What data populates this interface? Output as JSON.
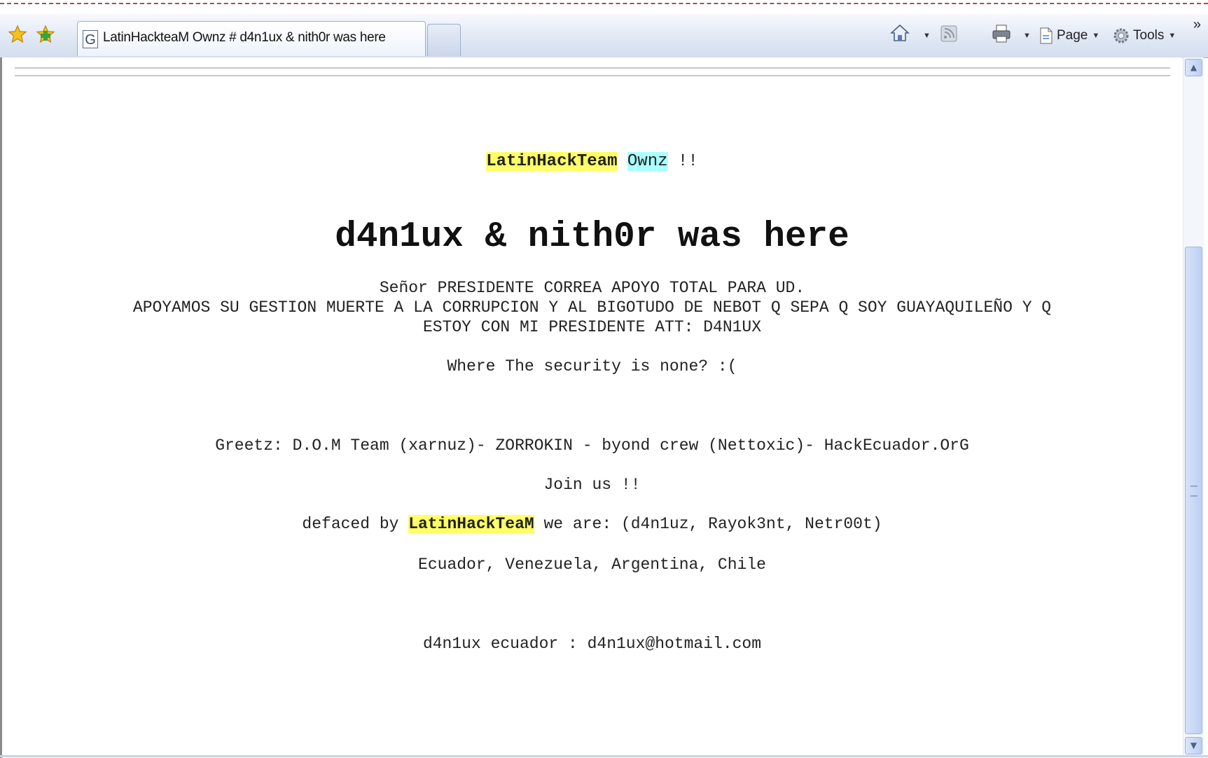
{
  "browser": {
    "tab_title": "LatinHackteaM Ownz # d4n1ux & nith0r was here",
    "tab_favicon": "G",
    "commands": {
      "page_label": "Page",
      "tools_label": "Tools",
      "overflow": "»"
    },
    "icons": [
      "favorites-star-icon",
      "add-favorites-icon",
      "home-icon",
      "feeds-icon",
      "print-icon",
      "page-icon",
      "tools-gear-icon"
    ]
  },
  "page": {
    "banner": {
      "name": "LatinHackTeam",
      "ownz": "Ownz",
      "exclaim": "!!"
    },
    "heading": "d4n1ux & nith0r was here",
    "message_line1": "Señor PRESIDENTE CORREA APOYO TOTAL PARA UD.",
    "message_line2": "APOYAMOS SU GESTION MUERTE A LA CORRUPCION Y AL BIGOTUDO DE NEBOT Q SEPA Q SOY GUAYAQUILEÑO Y Q",
    "message_line3": "ESTOY CON MI PRESIDENTE ATT: D4N1UX",
    "security_line": "Where The security is none? :(",
    "greetz": "Greetz: D.O.M Team (xarnuz)- ZORROKIN - byond crew (Nettoxic)- HackEcuador.OrG",
    "join": "Join us !!",
    "defaced": {
      "prefix": "defaced by",
      "team": "LatinHackTeaM",
      "suffix": "we are: (d4n1uz, Rayok3nt, Netr00t)"
    },
    "countries": "Ecuador, Venezuela, Argentina, Chile",
    "contact": "d4n1ux ecuador : d4n1ux@hotmail.com"
  },
  "colors": {
    "highlight_yellow": "#ffff66",
    "highlight_cyan": "#aaffff"
  }
}
